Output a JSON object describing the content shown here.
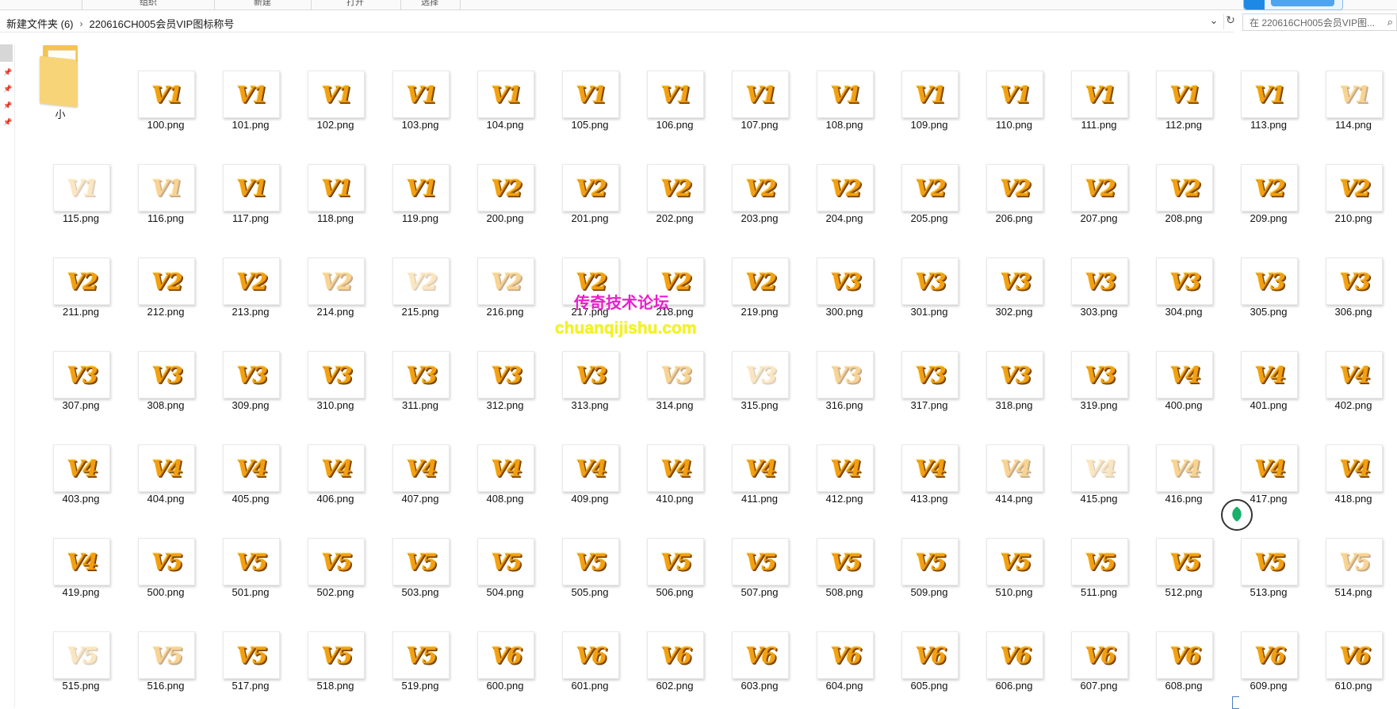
{
  "ribbon": {
    "groups": [
      "组织",
      "新建",
      "打开",
      "选择"
    ]
  },
  "breadcrumb": {
    "parent": "新建文件夹 (6)",
    "current": "220616CH005会员VIP图标称号"
  },
  "search": {
    "placeholder": "在 220616CH005会员VIP图..."
  },
  "folder": {
    "label": "小"
  },
  "files": [
    {
      "name": "100.png",
      "tier": "V1",
      "alpha": "full"
    },
    {
      "name": "101.png",
      "tier": "V1",
      "alpha": "full"
    },
    {
      "name": "102.png",
      "tier": "V1",
      "alpha": "full"
    },
    {
      "name": "103.png",
      "tier": "V1",
      "alpha": "full"
    },
    {
      "name": "104.png",
      "tier": "V1",
      "alpha": "full"
    },
    {
      "name": "105.png",
      "tier": "V1",
      "alpha": "full"
    },
    {
      "name": "106.png",
      "tier": "V1",
      "alpha": "full"
    },
    {
      "name": "107.png",
      "tier": "V1",
      "alpha": "full"
    },
    {
      "name": "108.png",
      "tier": "V1",
      "alpha": "full"
    },
    {
      "name": "109.png",
      "tier": "V1",
      "alpha": "full"
    },
    {
      "name": "110.png",
      "tier": "V1",
      "alpha": "full"
    },
    {
      "name": "111.png",
      "tier": "V1",
      "alpha": "full"
    },
    {
      "name": "112.png",
      "tier": "V1",
      "alpha": "full"
    },
    {
      "name": "113.png",
      "tier": "V1",
      "alpha": "full"
    },
    {
      "name": "114.png",
      "tier": "V1",
      "alpha": "faded"
    },
    {
      "name": "115.png",
      "tier": "V1",
      "alpha": "faint"
    },
    {
      "name": "116.png",
      "tier": "V1",
      "alpha": "faded"
    },
    {
      "name": "117.png",
      "tier": "V1",
      "alpha": "full"
    },
    {
      "name": "118.png",
      "tier": "V1",
      "alpha": "full"
    },
    {
      "name": "119.png",
      "tier": "V1",
      "alpha": "full"
    },
    {
      "name": "200.png",
      "tier": "V2",
      "alpha": "full"
    },
    {
      "name": "201.png",
      "tier": "V2",
      "alpha": "full"
    },
    {
      "name": "202.png",
      "tier": "V2",
      "alpha": "full"
    },
    {
      "name": "203.png",
      "tier": "V2",
      "alpha": "full"
    },
    {
      "name": "204.png",
      "tier": "V2",
      "alpha": "full"
    },
    {
      "name": "205.png",
      "tier": "V2",
      "alpha": "full"
    },
    {
      "name": "206.png",
      "tier": "V2",
      "alpha": "full"
    },
    {
      "name": "207.png",
      "tier": "V2",
      "alpha": "full"
    },
    {
      "name": "208.png",
      "tier": "V2",
      "alpha": "full"
    },
    {
      "name": "209.png",
      "tier": "V2",
      "alpha": "full"
    },
    {
      "name": "210.png",
      "tier": "V2",
      "alpha": "full"
    },
    {
      "name": "211.png",
      "tier": "V2",
      "alpha": "full"
    },
    {
      "name": "212.png",
      "tier": "V2",
      "alpha": "full"
    },
    {
      "name": "213.png",
      "tier": "V2",
      "alpha": "full"
    },
    {
      "name": "214.png",
      "tier": "V2",
      "alpha": "faded"
    },
    {
      "name": "215.png",
      "tier": "V2",
      "alpha": "faint"
    },
    {
      "name": "216.png",
      "tier": "V2",
      "alpha": "faded"
    },
    {
      "name": "217.png",
      "tier": "V2",
      "alpha": "full"
    },
    {
      "name": "218.png",
      "tier": "V2",
      "alpha": "full"
    },
    {
      "name": "219.png",
      "tier": "V2",
      "alpha": "full"
    },
    {
      "name": "300.png",
      "tier": "V3",
      "alpha": "full"
    },
    {
      "name": "301.png",
      "tier": "V3",
      "alpha": "full"
    },
    {
      "name": "302.png",
      "tier": "V3",
      "alpha": "full"
    },
    {
      "name": "303.png",
      "tier": "V3",
      "alpha": "full"
    },
    {
      "name": "304.png",
      "tier": "V3",
      "alpha": "full"
    },
    {
      "name": "305.png",
      "tier": "V3",
      "alpha": "full"
    },
    {
      "name": "306.png",
      "tier": "V3",
      "alpha": "full"
    },
    {
      "name": "307.png",
      "tier": "V3",
      "alpha": "full"
    },
    {
      "name": "308.png",
      "tier": "V3",
      "alpha": "full"
    },
    {
      "name": "309.png",
      "tier": "V3",
      "alpha": "full"
    },
    {
      "name": "310.png",
      "tier": "V3",
      "alpha": "full"
    },
    {
      "name": "311.png",
      "tier": "V3",
      "alpha": "full"
    },
    {
      "name": "312.png",
      "tier": "V3",
      "alpha": "full"
    },
    {
      "name": "313.png",
      "tier": "V3",
      "alpha": "full"
    },
    {
      "name": "314.png",
      "tier": "V3",
      "alpha": "faded"
    },
    {
      "name": "315.png",
      "tier": "V3",
      "alpha": "faint"
    },
    {
      "name": "316.png",
      "tier": "V3",
      "alpha": "faded"
    },
    {
      "name": "317.png",
      "tier": "V3",
      "alpha": "full"
    },
    {
      "name": "318.png",
      "tier": "V3",
      "alpha": "full"
    },
    {
      "name": "319.png",
      "tier": "V3",
      "alpha": "full"
    },
    {
      "name": "400.png",
      "tier": "V4",
      "alpha": "full"
    },
    {
      "name": "401.png",
      "tier": "V4",
      "alpha": "full"
    },
    {
      "name": "402.png",
      "tier": "V4",
      "alpha": "full"
    },
    {
      "name": "403.png",
      "tier": "V4",
      "alpha": "full"
    },
    {
      "name": "404.png",
      "tier": "V4",
      "alpha": "full"
    },
    {
      "name": "405.png",
      "tier": "V4",
      "alpha": "full"
    },
    {
      "name": "406.png",
      "tier": "V4",
      "alpha": "full"
    },
    {
      "name": "407.png",
      "tier": "V4",
      "alpha": "full"
    },
    {
      "name": "408.png",
      "tier": "V4",
      "alpha": "full"
    },
    {
      "name": "409.png",
      "tier": "V4",
      "alpha": "full"
    },
    {
      "name": "410.png",
      "tier": "V4",
      "alpha": "full"
    },
    {
      "name": "411.png",
      "tier": "V4",
      "alpha": "full"
    },
    {
      "name": "412.png",
      "tier": "V4",
      "alpha": "full"
    },
    {
      "name": "413.png",
      "tier": "V4",
      "alpha": "full"
    },
    {
      "name": "414.png",
      "tier": "V4",
      "alpha": "faded"
    },
    {
      "name": "415.png",
      "tier": "V4",
      "alpha": "faint"
    },
    {
      "name": "416.png",
      "tier": "V4",
      "alpha": "faded"
    },
    {
      "name": "417.png",
      "tier": "V4",
      "alpha": "full"
    },
    {
      "name": "418.png",
      "tier": "V4",
      "alpha": "full"
    },
    {
      "name": "419.png",
      "tier": "V4",
      "alpha": "full"
    },
    {
      "name": "500.png",
      "tier": "V5",
      "alpha": "full"
    },
    {
      "name": "501.png",
      "tier": "V5",
      "alpha": "full"
    },
    {
      "name": "502.png",
      "tier": "V5",
      "alpha": "full"
    },
    {
      "name": "503.png",
      "tier": "V5",
      "alpha": "full"
    },
    {
      "name": "504.png",
      "tier": "V5",
      "alpha": "full"
    },
    {
      "name": "505.png",
      "tier": "V5",
      "alpha": "full"
    },
    {
      "name": "506.png",
      "tier": "V5",
      "alpha": "full"
    },
    {
      "name": "507.png",
      "tier": "V5",
      "alpha": "full"
    },
    {
      "name": "508.png",
      "tier": "V5",
      "alpha": "full"
    },
    {
      "name": "509.png",
      "tier": "V5",
      "alpha": "full"
    },
    {
      "name": "510.png",
      "tier": "V5",
      "alpha": "full"
    },
    {
      "name": "511.png",
      "tier": "V5",
      "alpha": "full"
    },
    {
      "name": "512.png",
      "tier": "V5",
      "alpha": "full"
    },
    {
      "name": "513.png",
      "tier": "V5",
      "alpha": "full"
    },
    {
      "name": "514.png",
      "tier": "V5",
      "alpha": "faded"
    },
    {
      "name": "515.png",
      "tier": "V5",
      "alpha": "faint"
    },
    {
      "name": "516.png",
      "tier": "V5",
      "alpha": "faded"
    },
    {
      "name": "517.png",
      "tier": "V5",
      "alpha": "full"
    },
    {
      "name": "518.png",
      "tier": "V5",
      "alpha": "full"
    },
    {
      "name": "519.png",
      "tier": "V5",
      "alpha": "full"
    },
    {
      "name": "600.png",
      "tier": "V6",
      "alpha": "full"
    },
    {
      "name": "601.png",
      "tier": "V6",
      "alpha": "full"
    },
    {
      "name": "602.png",
      "tier": "V6",
      "alpha": "full"
    },
    {
      "name": "603.png",
      "tier": "V6",
      "alpha": "full"
    },
    {
      "name": "604.png",
      "tier": "V6",
      "alpha": "full"
    },
    {
      "name": "605.png",
      "tier": "V6",
      "alpha": "full"
    },
    {
      "name": "606.png",
      "tier": "V6",
      "alpha": "full"
    },
    {
      "name": "607.png",
      "tier": "V6",
      "alpha": "full"
    },
    {
      "name": "608.png",
      "tier": "V6",
      "alpha": "full"
    },
    {
      "name": "609.png",
      "tier": "V6",
      "alpha": "full"
    },
    {
      "name": "610.png",
      "tier": "V6",
      "alpha": "full"
    }
  ],
  "watermark": {
    "line1": "传奇技术论坛",
    "line2": "chuanqijishu.com"
  },
  "icons": {
    "folder": "folder-icon",
    "refresh": "refresh-icon",
    "search": "search-icon",
    "dropdown": "chevron-down-icon",
    "pin": "pin-icon",
    "float": "leaf-icon"
  },
  "colors": {
    "badge_gold": "#f2a012",
    "watermark_magenta": "#e91ecb",
    "watermark_yellow": "#f5f51a",
    "folder_yellow": "#f4c453"
  }
}
